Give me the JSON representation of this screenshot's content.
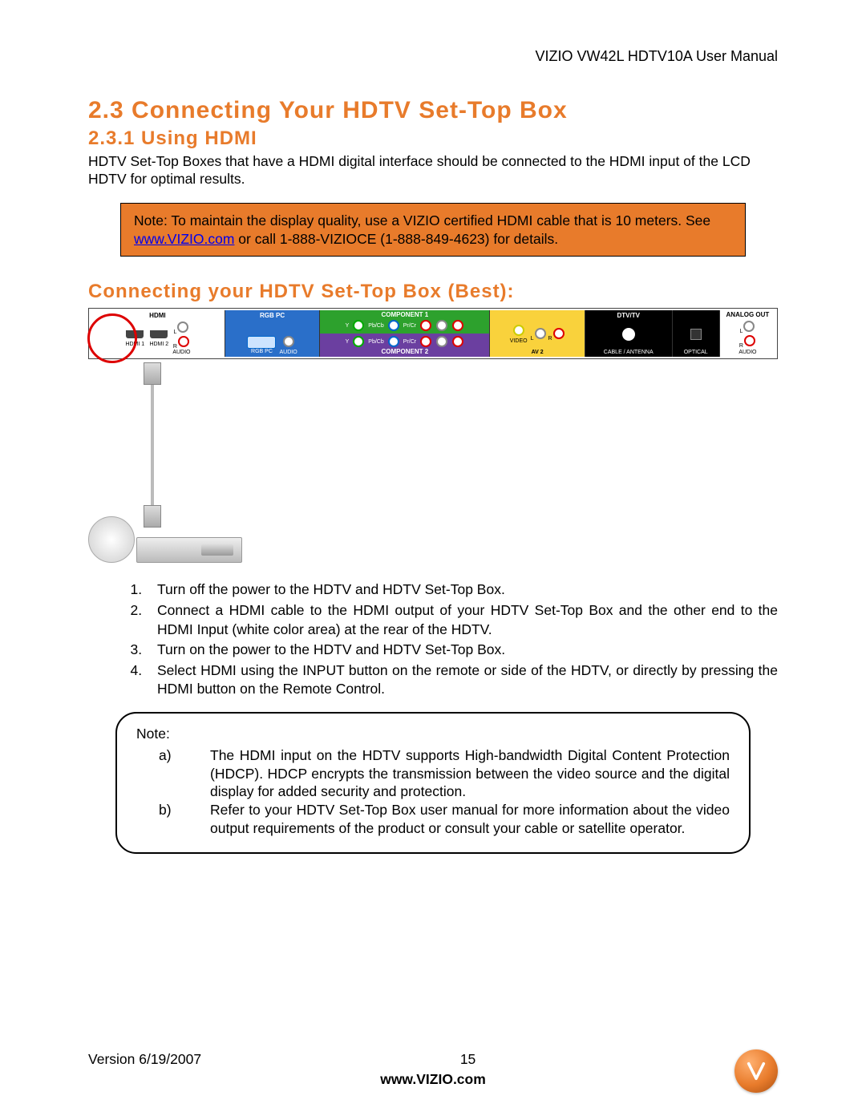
{
  "header": {
    "manual_title": "VIZIO VW42L HDTV10A User Manual"
  },
  "section": {
    "h1": "2.3 Connecting Your HDTV Set-Top Box",
    "h2": "2.3.1 Using HDMI",
    "intro": "HDTV Set-Top Boxes that have a HDMI digital interface should be connected to the HDMI input of the LCD HDTV for optimal results."
  },
  "note_box": {
    "line1_prefix": "Note: To maintain the display quality, use a VIZIO certified HDMI cable that is 10 meters. See ",
    "link_text": "www.VIZIO.com",
    "line1_suffix": " or call 1-888-VIZIOCE (1-888-849-4623) for details."
  },
  "conn_title": "Connecting your HDTV Set-Top Box (Best):",
  "panel": {
    "hdmi_group": "HDMI",
    "hdmi1": "HDMI 1",
    "hdmi2": "HDMI 2",
    "audio_lr": "AUDIO",
    "l": "L",
    "r": "R",
    "rgb": "RGB PC",
    "comp1": "COMPONENT 1",
    "comp2": "COMPONENT 2",
    "y": "Y",
    "pb": "Pb/Cb",
    "pr": "Pr/Cr",
    "av2": "AV 2",
    "video": "VIDEO",
    "dtv": "DTV/TV",
    "cable": "CABLE / ANTENNA",
    "optical": "OPTICAL",
    "analog_out": "ANALOG OUT"
  },
  "steps": [
    "Turn off the power to the HDTV and HDTV Set-Top Box.",
    "Connect a HDMI cable to the HDMI output of your HDTV Set-Top Box and the other end to the HDMI Input (white color area) at the rear of the HDTV.",
    "Turn on the power to the HDTV and HDTV Set-Top Box.",
    "Select HDMI using the INPUT button on the remote or side of the HDTV, or directly by pressing the HDMI button on the Remote Control."
  ],
  "note_round": {
    "label": "Note:",
    "a_letter": "a)",
    "a": "The HDMI input on the HDTV supports High-bandwidth Digital Content Protection (HDCP).  HDCP encrypts the transmission between the video source and the digital display for added security and protection.",
    "b_letter": "b)",
    "b": "Refer to your HDTV Set-Top Box user manual for more information about the video output requirements of the product or consult your cable or satellite operator."
  },
  "footer": {
    "version": "Version 6/19/2007",
    "page": "15",
    "site": "www.VIZIO.com"
  }
}
